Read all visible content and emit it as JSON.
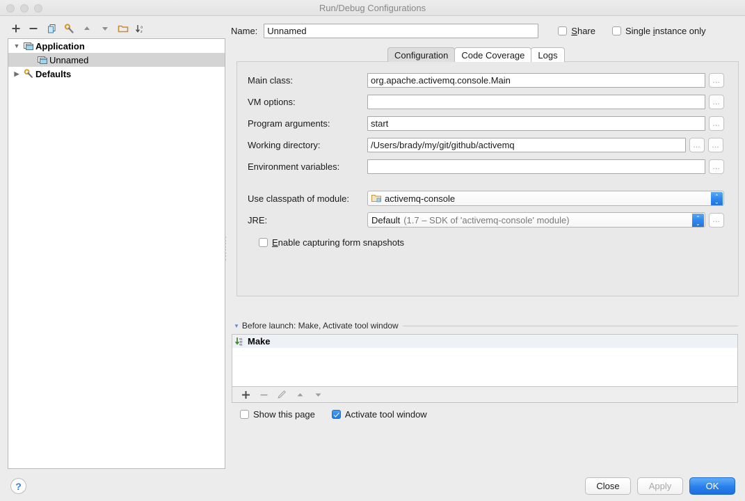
{
  "window": {
    "title": "Run/Debug Configurations",
    "traffic_lights": [
      "close-button",
      "minimize-button",
      "zoom-button"
    ]
  },
  "left_panel": {
    "toolbar": [
      {
        "name": "add-configuration-button",
        "icon": "plus-icon"
      },
      {
        "name": "remove-configuration-button",
        "icon": "minus-icon"
      },
      {
        "name": "copy-configuration-button",
        "icon": "copy-icon"
      },
      {
        "name": "edit-defaults-button",
        "icon": "wrench-icon"
      },
      {
        "name": "move-up-button",
        "icon": "triangle-up-icon"
      },
      {
        "name": "move-down-button",
        "icon": "triangle-down-icon"
      },
      {
        "name": "create-folder-button",
        "icon": "folder-icon"
      },
      {
        "name": "sort-configurations-button",
        "icon": "sort-az-icon"
      }
    ],
    "tree": [
      {
        "label": "Application",
        "icon": "application-icon",
        "twisty": "▼",
        "indent": 0,
        "bold": true,
        "selected": false
      },
      {
        "label": "Unnamed",
        "icon": "application-icon",
        "twisty": "",
        "indent": 1,
        "bold": false,
        "selected": true
      },
      {
        "label": "Defaults",
        "icon": "wrench-icon",
        "twisty": "▶",
        "indent": 0,
        "bold": true,
        "selected": false
      }
    ],
    "help_button_label": "?"
  },
  "header": {
    "name_label": "Name:",
    "name_value": "Unnamed",
    "name_placeholder": "Unnamed",
    "share": {
      "label": "Share",
      "mnemonic": "S",
      "checked": false
    },
    "single_instance": {
      "label_before": "Single ",
      "mnemonic": "i",
      "label_after": "nstance only",
      "checked": false
    }
  },
  "tabs": [
    {
      "label": "Configuration",
      "active": true
    },
    {
      "label": "Code Coverage",
      "active": false
    },
    {
      "label": "Logs",
      "active": false
    }
  ],
  "configuration": {
    "fields": [
      {
        "label": "Main class:",
        "value": "org.apache.activemq.console.Main",
        "placeholder": "",
        "browse": 1
      },
      {
        "label": "VM options:",
        "value": "",
        "placeholder": "",
        "browse": 1
      },
      {
        "label": "Program arguments:",
        "value": "start",
        "placeholder": "",
        "browse": 1
      },
      {
        "label": "Working directory:",
        "value": "/Users/brady/my/git/github/activemq",
        "placeholder": "",
        "browse": 2
      },
      {
        "label": "Environment variables:",
        "value": "",
        "placeholder": "",
        "browse": 1
      }
    ],
    "module": {
      "label": "Use classpath of module:",
      "value": "activemq-console",
      "icon": "module-folder-icon"
    },
    "jre": {
      "label": "JRE:",
      "value": "Default",
      "detail": "(1.7 – SDK of 'activemq-console' module)",
      "browse": 1
    },
    "snapshots": {
      "mnemonic": "E",
      "label_after": "nable capturing form snapshots",
      "checked": false
    }
  },
  "before_launch": {
    "title": "Before launch: Make, Activate tool window",
    "items": [
      {
        "label": "Make",
        "icon": "make-icon",
        "selected": true
      }
    ],
    "toolbar": [
      {
        "name": "add-task-button",
        "icon": "plus-icon",
        "enabled": true
      },
      {
        "name": "remove-task-button",
        "icon": "minus-icon",
        "enabled": false
      },
      {
        "name": "edit-task-button",
        "icon": "pencil-icon",
        "enabled": false
      },
      {
        "name": "move-task-up-button",
        "icon": "triangle-up-icon",
        "enabled": false
      },
      {
        "name": "move-task-down-button",
        "icon": "triangle-down-icon",
        "enabled": false
      }
    ],
    "show_this_page": {
      "label": "Show this page",
      "checked": false
    },
    "activate_tool_window": {
      "label": "Activate tool window",
      "checked": true
    }
  },
  "dialog_buttons": [
    {
      "label": "Close",
      "name": "close-button",
      "style": "default"
    },
    {
      "label": "Apply",
      "name": "apply-button",
      "style": "disabled"
    },
    {
      "label": "OK",
      "name": "ok-button",
      "style": "primary"
    }
  ],
  "colors": {
    "accent": "#2f85ee",
    "window_bg": "#ececec",
    "panel_bg": "#e9e9e9",
    "selection": "#d4d4d4",
    "folder_orange": "#d9a441",
    "make_green": "#4a9b3c",
    "help_blue": "#2f7fe0"
  }
}
